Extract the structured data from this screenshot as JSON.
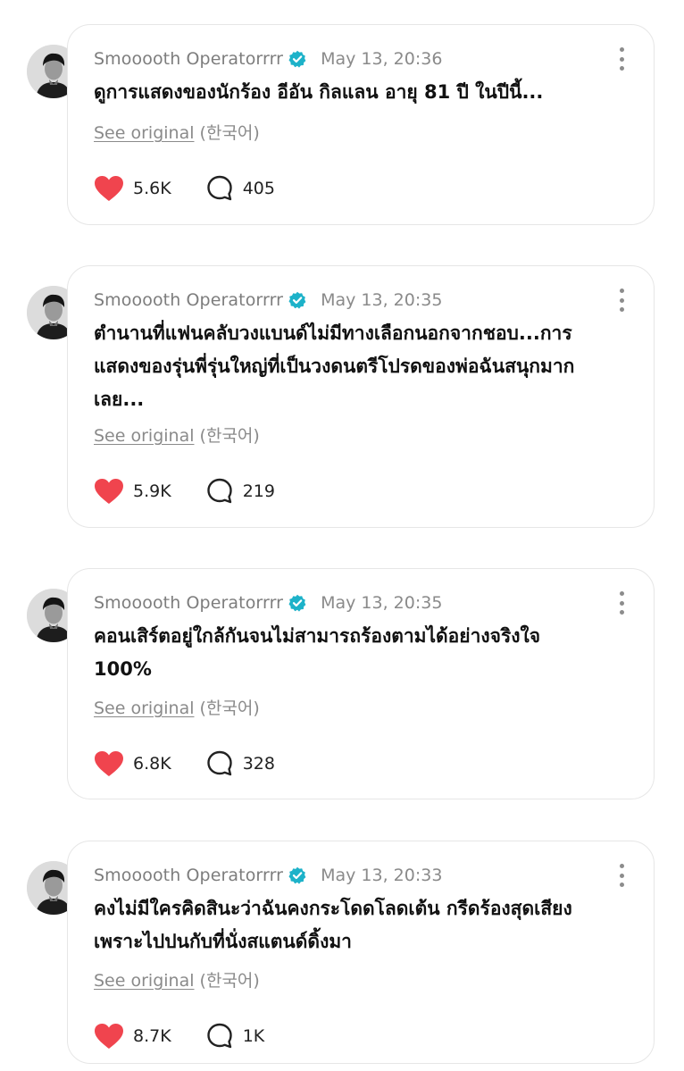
{
  "posts": [
    {
      "author": "Smooooth Operatorrrr",
      "time": "May 13, 20:36",
      "lines": [
        "ดูการแสดงของนักร้อง อีอัน กิลแลน อายุ 81 ปี ในปีนี้..."
      ],
      "see_original": "See original",
      "language": "(한국어)",
      "likes": "5.6K",
      "comments": "405"
    },
    {
      "author": "Smooooth Operatorrrr",
      "time": "May 13, 20:35",
      "lines": [
        "ตำนานที่แฟนคลับวงแบนด์ไม่มีทางเลือกนอกจากชอบ...การ",
        "แสดงของรุ่นพี่รุ่นใหญ่ที่เป็นวงดนตรีโปรดของพ่อฉันสนุกมาก",
        "เลย..."
      ],
      "see_original": "See original",
      "language": "(한국어)",
      "likes": "5.9K",
      "comments": "219"
    },
    {
      "author": "Smooooth Operatorrrr",
      "time": "May 13, 20:35",
      "lines": [
        "คอนเสิร์ตอยู่ใกล้กันจนไม่สามารถร้องตามได้อย่างจริงใจ",
        "100%"
      ],
      "see_original": "See original",
      "language": "(한국어)",
      "likes": "6.8K",
      "comments": "328"
    },
    {
      "author": "Smooooth Operatorrrr",
      "time": "May 13, 20:33",
      "lines": [
        "คงไม่มีใครคิดสินะว่าฉันคงกระโดดโลดเต้น กรีดร้องสุดเสียง",
        "เพราะไปปนกับที่นั่งสแตนด์ดิ้งมา"
      ],
      "see_original": "See original",
      "language": "(한국어)",
      "likes": "8.7K",
      "comments": "1K"
    }
  ],
  "colors": {
    "heart": "#f0444e",
    "verified": "#1db2c9",
    "muted_text": "#8a8a8a",
    "card_border": "#e6e6e6"
  },
  "icons": {
    "like": "heart-icon",
    "comment": "comment-bubble-icon",
    "verified": "verified-badge-icon",
    "more": "more-vertical-icon"
  }
}
